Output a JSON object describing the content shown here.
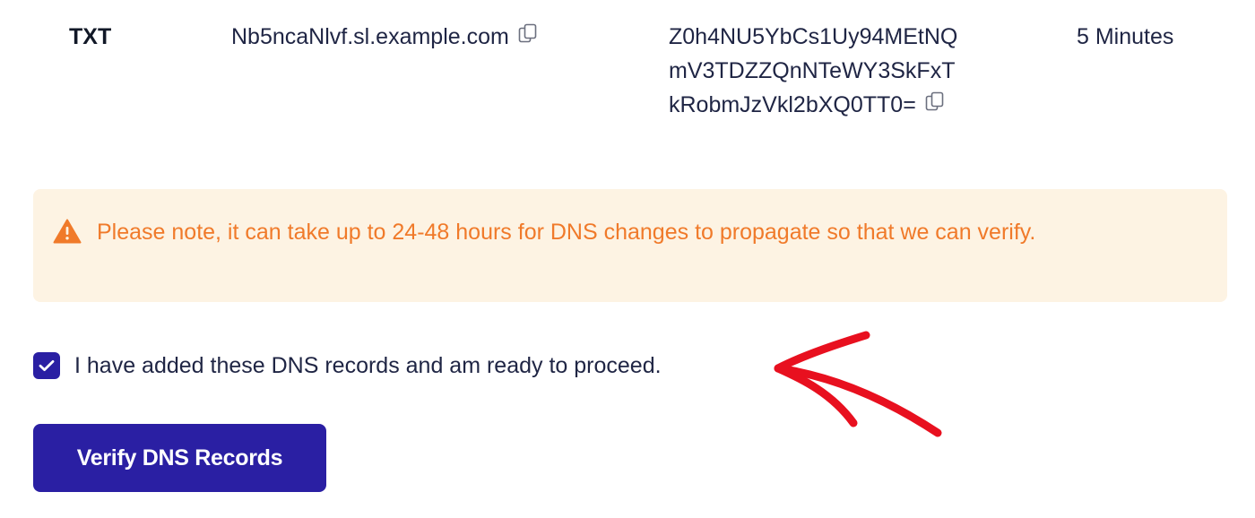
{
  "record": {
    "type": "TXT",
    "host": "Nb5ncaNlvf.sl.example.com",
    "value_lines": [
      "Z0h4NU5YbCs1Uy94MEtNQ",
      "mV3TDZZQnNTeWY3SkFxT",
      "kRobmJzVkl2bXQ0TT0="
    ],
    "ttl": "5 Minutes"
  },
  "notice": {
    "text": "Please note, it can take up to 24-48 hours for DNS changes to propagate so that we can verify.",
    "icon": "warning-triangle-icon",
    "color": "#f07a2a",
    "background": "#fdf3e3"
  },
  "confirm": {
    "label": "I have added these DNS records and am ready to proceed.",
    "checked": true
  },
  "verify_button": {
    "label": "Verify DNS Records",
    "color": "#2a1fa3"
  },
  "annotation": {
    "icon": "red-arrow-annotation",
    "color": "#e8101f"
  }
}
